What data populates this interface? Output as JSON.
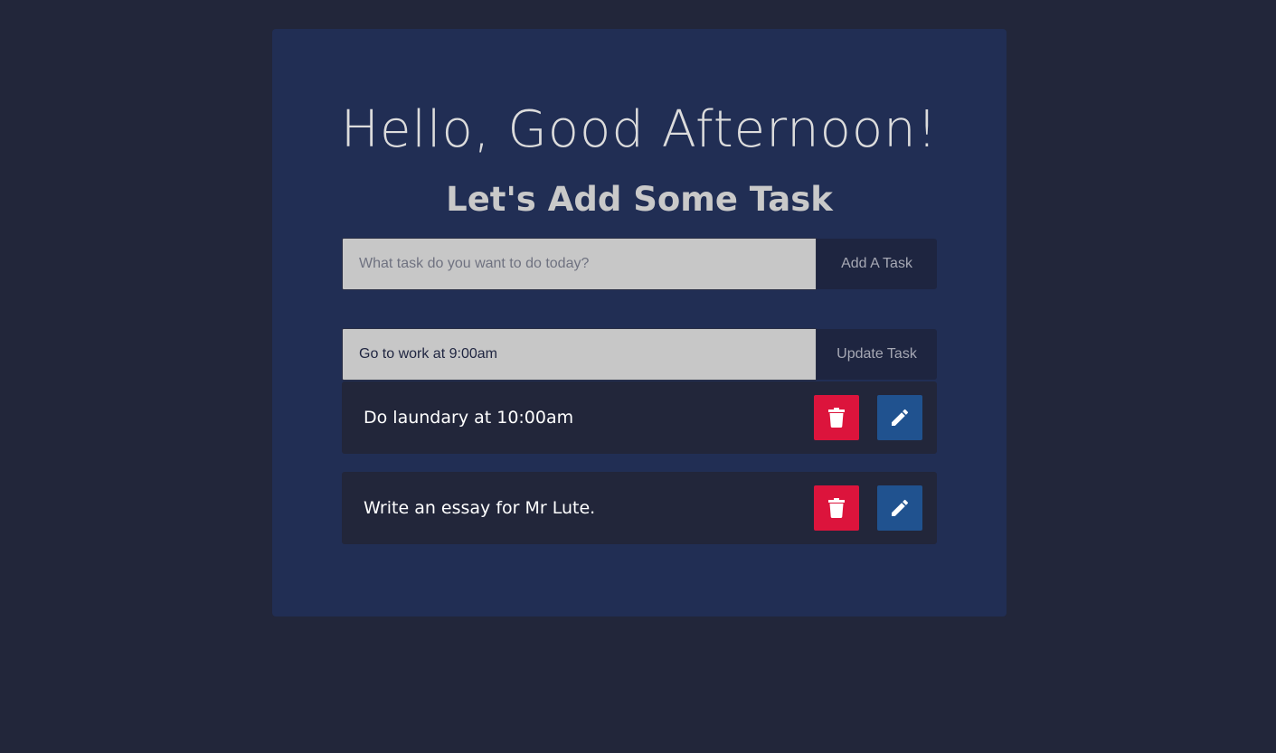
{
  "header": {
    "greeting": "Hello, Good Afternoon!",
    "subtitle": "Let's Add Some Task"
  },
  "add_form": {
    "placeholder": "What task do you want to do today?",
    "value": "",
    "button_label": "Add A Task"
  },
  "update_form": {
    "value": "Go to work at 9:00am",
    "button_label": "Update Task"
  },
  "tasks": [
    {
      "text": "Do laundary at 10:00am",
      "delete_icon": "trash-icon",
      "edit_icon": "pencil-icon"
    },
    {
      "text": "Write an essay for Mr Lute.",
      "delete_icon": "trash-icon",
      "edit_icon": "pencil-icon"
    }
  ],
  "colors": {
    "page_background": "#22263a",
    "card_background": "#212e54",
    "input_background": "#c7c7c7",
    "button_background": "#1e2540",
    "delete_button": "#dc143c",
    "edit_button": "#20528f",
    "task_background": "#22263a"
  }
}
